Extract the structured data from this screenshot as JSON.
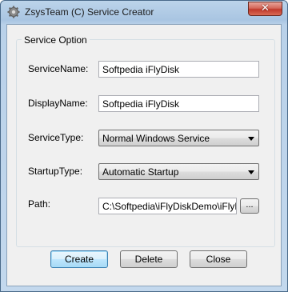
{
  "window": {
    "title": "ZsysTeam (C) Service Creator",
    "close_glyph": "✕"
  },
  "group": {
    "title": "Service Option"
  },
  "fields": {
    "service_name": {
      "label": "ServiceName:",
      "value": "Softpedia iFlyDisk"
    },
    "display_name": {
      "label": "DisplayName:",
      "value": "Softpedia iFlyDisk"
    },
    "service_type": {
      "label": "ServiceType:",
      "value": "Normal Windows Service"
    },
    "startup_type": {
      "label": "StartupType:",
      "value": "Automatic Startup"
    },
    "path": {
      "label": "Path:",
      "value": "C:\\Softpedia\\iFlyDiskDemo\\iFlyDisk",
      "browse_label": "..."
    }
  },
  "buttons": {
    "create": "Create",
    "delete": "Delete",
    "close": "Close"
  },
  "icons": {
    "app": "gear-icon",
    "close": "close-icon",
    "dropdown": "chevron-down-icon"
  }
}
